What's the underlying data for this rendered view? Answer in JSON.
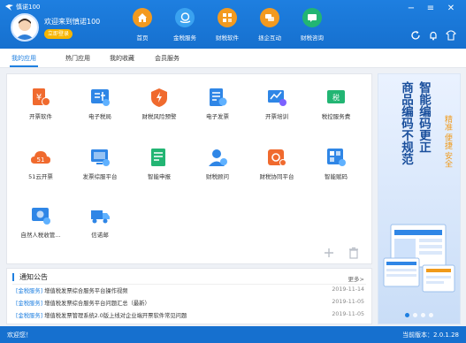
{
  "app": {
    "brand_name": "慎诺100",
    "welcome_text": "欢迎来到慎诺100",
    "login_label": "立即登录",
    "colors": {
      "primary": "#1e7fe0",
      "banner_text": "#1a4f9c",
      "accent": "#f09a1a",
      "login": "#f7b500"
    }
  },
  "nav": {
    "items": [
      {
        "label": "首页",
        "icon": "home-icon",
        "color": "#f39a1f"
      },
      {
        "label": "金税服务",
        "icon": "tax-service-icon",
        "color": "#3aa2f0"
      },
      {
        "label": "财税软件",
        "icon": "software-icon",
        "color": "#f39a1f"
      },
      {
        "label": "拯企互动",
        "icon": "interaction-icon",
        "color": "#f39a1f"
      },
      {
        "label": "财税咨询",
        "icon": "consult-icon",
        "color": "#22b573"
      }
    ]
  },
  "window": {
    "minimize": "−",
    "menu": "≡",
    "close": "✕"
  },
  "tabs": [
    {
      "label": "我的应用",
      "active": true
    },
    {
      "label": "热门应用",
      "active": false
    },
    {
      "label": "我的收藏",
      "active": false
    },
    {
      "label": "会员服务",
      "active": false
    }
  ],
  "apps": [
    {
      "label": "开票软件",
      "icon": "invoice-software-icon"
    },
    {
      "label": "电子税局",
      "icon": "e-tax-bureau-icon"
    },
    {
      "label": "财税风险预警",
      "icon": "risk-warning-icon"
    },
    {
      "label": "电子发票",
      "icon": "e-invoice-icon"
    },
    {
      "label": "开票培训",
      "icon": "training-icon"
    },
    {
      "label": "税控服务费",
      "icon": "tax-control-fee-icon"
    },
    {
      "label": "51云开票",
      "icon": "cloud-invoice-icon"
    },
    {
      "label": "发票综服平台",
      "icon": "invoice-platform-icon"
    },
    {
      "label": "智能申报",
      "icon": "smart-declare-icon"
    },
    {
      "label": "财税顾问",
      "icon": "advisor-icon"
    },
    {
      "label": "财税协同平台",
      "icon": "collab-platform-icon"
    },
    {
      "label": "智能赋码",
      "icon": "smart-coding-icon"
    },
    {
      "label": "自然人税收管...",
      "icon": "personal-tax-icon"
    },
    {
      "label": "信诺邮",
      "icon": "mail-truck-icon"
    }
  ],
  "notice": {
    "title": "通知公告",
    "more_label": "更多>",
    "items": [
      {
        "tag": "[金税服务]",
        "text": "增值税发票综合服务平台操作视频",
        "date": "2019-11-14"
      },
      {
        "tag": "[金税服务]",
        "text": "增值税发票综合服务平台问题汇总（最新）",
        "date": "2019-11-05"
      },
      {
        "tag": "[金税服务]",
        "text": "增值税发票管理系统2.0版上线对企业端开票软件常见问题",
        "date": "2019-11-05"
      }
    ]
  },
  "banner": {
    "col1": "智能编码更正",
    "col2": "商品编码不规范",
    "sub": "精准 便捷 安全"
  },
  "status": {
    "left": "欢迎您！",
    "right": "当前版本：2.0.1.28"
  }
}
